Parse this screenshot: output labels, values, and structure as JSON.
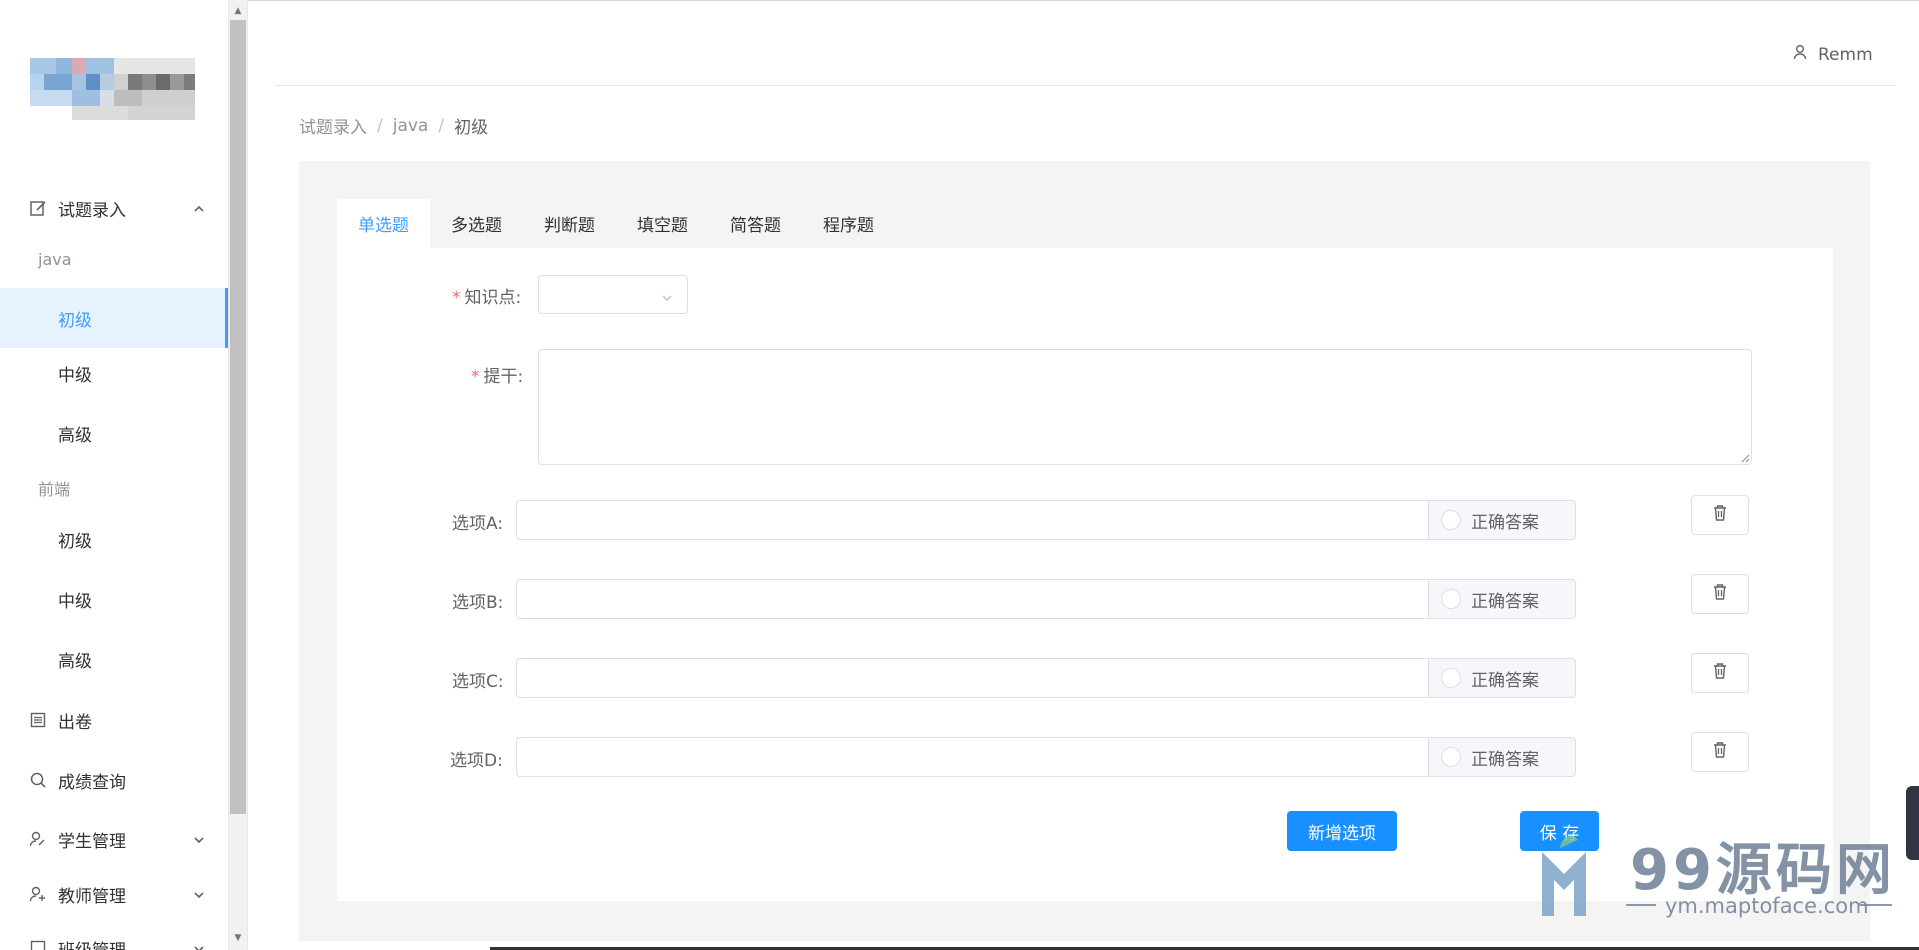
{
  "user": {
    "name": "Remm",
    "icon": "user-icon"
  },
  "sidebar": {
    "menu1": {
      "label": "试题录入",
      "icon": "edit-icon"
    },
    "group1": "java",
    "group1_items": [
      "初级",
      "中级",
      "高级"
    ],
    "group2": "前端",
    "group2_items": [
      "初级",
      "中级",
      "高级"
    ],
    "menu2": {
      "label": "出卷",
      "icon": "document-icon"
    },
    "menu3": {
      "label": "成绩查询",
      "icon": "search-icon"
    },
    "menu4": {
      "label": "学生管理",
      "icon": "user-edit-icon"
    },
    "menu5": {
      "label": "教师管理",
      "icon": "user-add-icon"
    },
    "menu6": {
      "label": "班级管理",
      "icon": "class-icon"
    }
  },
  "breadcrumb": [
    "试题录入",
    "java",
    "初级"
  ],
  "breadcrumb_sep": "/",
  "tabs": [
    "单选题",
    "多选题",
    "判断题",
    "填空题",
    "简答题",
    "程序题"
  ],
  "form": {
    "knowledge_label": "知识点:",
    "stem_label": "提干:",
    "required_mark": "*",
    "options": [
      {
        "label": "选项A:"
      },
      {
        "label": "选项B:"
      },
      {
        "label": "选项C:"
      },
      {
        "label": "选项D:"
      }
    ],
    "correct_label": "正确答案",
    "add_option": "新增选项",
    "save": "保 存"
  },
  "watermark": {
    "brand": "99源码网",
    "url": "ym.maptoface.com"
  },
  "colors": {
    "accent": "#409eff",
    "primary_button": "#1890ff",
    "required": "#f56c6c"
  }
}
